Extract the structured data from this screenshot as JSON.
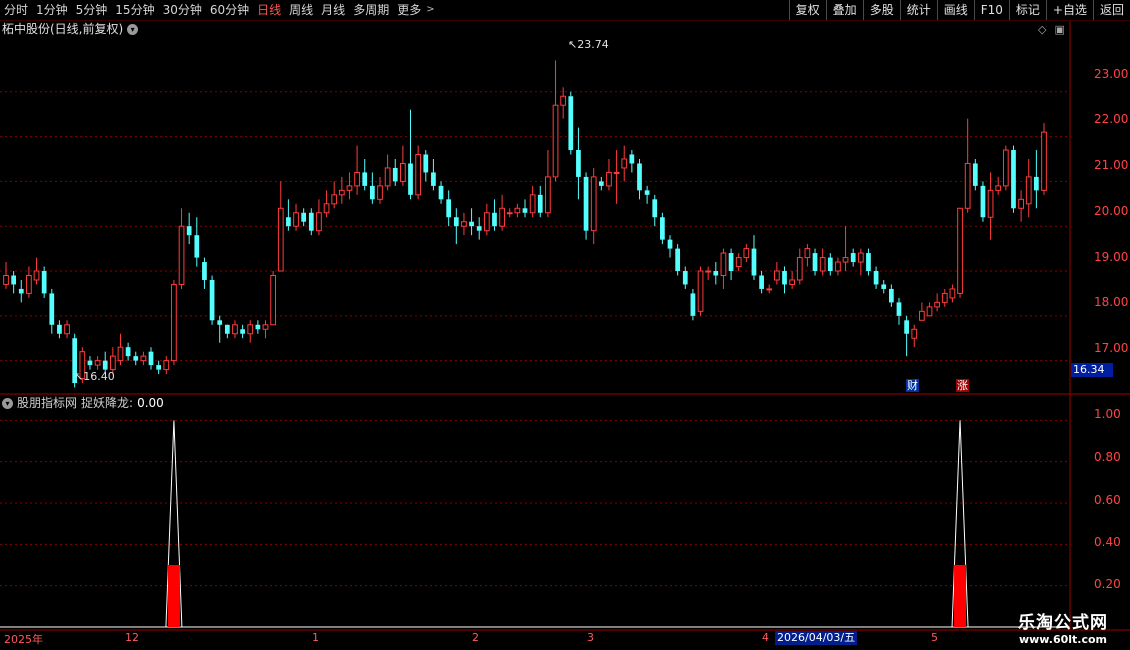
{
  "topbar": {
    "periods": [
      "分时",
      "1分钟",
      "5分钟",
      "15分钟",
      "30分钟",
      "60分钟",
      "日线",
      "周线",
      "月线",
      "多周期",
      "更多"
    ],
    "active_period": "日线",
    "more_caret": ">",
    "tools": [
      "复权",
      "叠加",
      "多股",
      "统计",
      "画线",
      "F10",
      "标记",
      "+自选",
      "返回"
    ]
  },
  "main_panel": {
    "title": "柘中股份(日线,前复权)",
    "high_label": "23.74",
    "low_label": "16.40",
    "current_price": "16.34",
    "price_axis": [
      "23.00",
      "22.00",
      "21.00",
      "20.00",
      "19.00",
      "18.00",
      "17.00"
    ],
    "badges": [
      "财",
      "涨"
    ]
  },
  "indicator_panel": {
    "name": "股朋指标网",
    "series_label": "捉妖降龙:",
    "series_value": "0.00",
    "axis": [
      "1.00",
      "0.80",
      "0.60",
      "0.40",
      "0.20"
    ]
  },
  "time_axis": {
    "labels": [
      "2025年",
      "12",
      "1",
      "2",
      "3",
      "4",
      "5"
    ],
    "selected_date": "2026/04/03/五"
  },
  "watermark": {
    "name": "乐淘公式网",
    "url": "www.60lt.com"
  },
  "colors": {
    "up": "#ff3c3c",
    "down": "#54ffff",
    "grid": "#8b0000",
    "background": "#000000"
  },
  "chart_data": {
    "type": "candlestick",
    "ylim": [
      16.3,
      24.2
    ],
    "candles": [
      [
        18.7,
        18.9,
        18.6,
        19.2
      ],
      [
        18.9,
        18.7,
        18.5,
        19.0
      ],
      [
        18.6,
        18.5,
        18.3,
        18.8
      ],
      [
        18.5,
        18.9,
        18.4,
        19.1
      ],
      [
        18.8,
        19.0,
        18.7,
        19.3
      ],
      [
        19.0,
        18.5,
        18.4,
        19.1
      ],
      [
        18.5,
        17.8,
        17.6,
        18.6
      ],
      [
        17.8,
        17.6,
        17.5,
        17.9
      ],
      [
        17.6,
        17.8,
        17.5,
        17.9
      ],
      [
        17.5,
        16.5,
        16.4,
        17.6
      ],
      [
        16.6,
        17.2,
        16.5,
        17.3
      ],
      [
        17.0,
        16.9,
        16.8,
        17.1
      ],
      [
        16.9,
        17.0,
        16.8,
        17.1
      ],
      [
        17.0,
        16.8,
        16.7,
        17.2
      ],
      [
        16.8,
        17.1,
        16.7,
        17.3
      ],
      [
        17.0,
        17.3,
        16.9,
        17.6
      ],
      [
        17.3,
        17.1,
        17.0,
        17.4
      ],
      [
        17.1,
        17.0,
        16.9,
        17.2
      ],
      [
        17.0,
        17.1,
        16.9,
        17.2
      ],
      [
        17.2,
        16.9,
        16.8,
        17.3
      ],
      [
        16.9,
        16.8,
        16.7,
        17.0
      ],
      [
        16.8,
        17.0,
        16.7,
        17.1
      ],
      [
        17.0,
        18.7,
        16.9,
        18.8
      ],
      [
        18.7,
        20.0,
        18.6,
        20.4
      ],
      [
        20.0,
        19.8,
        19.6,
        20.3
      ],
      [
        19.8,
        19.3,
        19.1,
        20.2
      ],
      [
        19.2,
        18.8,
        18.6,
        19.3
      ],
      [
        18.8,
        17.9,
        17.8,
        18.9
      ],
      [
        17.9,
        17.8,
        17.4,
        18.0
      ],
      [
        17.8,
        17.6,
        17.5,
        17.8
      ],
      [
        17.6,
        17.8,
        17.5,
        17.9
      ],
      [
        17.7,
        17.6,
        17.5,
        17.8
      ],
      [
        17.6,
        17.8,
        17.4,
        17.9
      ],
      [
        17.8,
        17.7,
        17.6,
        17.9
      ],
      [
        17.7,
        17.8,
        17.5,
        17.9
      ],
      [
        17.8,
        18.9,
        17.8,
        19.0
      ],
      [
        19.0,
        20.4,
        19.8,
        21.0
      ],
      [
        20.2,
        20.0,
        19.9,
        20.6
      ],
      [
        20.0,
        20.3,
        19.9,
        20.5
      ],
      [
        20.3,
        20.1,
        20.0,
        20.4
      ],
      [
        20.3,
        19.9,
        19.8,
        20.4
      ],
      [
        19.9,
        20.3,
        19.8,
        20.6
      ],
      [
        20.3,
        20.5,
        20.2,
        20.8
      ],
      [
        20.5,
        20.7,
        20.4,
        21.0
      ],
      [
        20.7,
        20.8,
        20.5,
        21.1
      ],
      [
        20.8,
        20.9,
        20.6,
        21.2
      ],
      [
        20.9,
        21.2,
        20.7,
        21.8
      ],
      [
        21.2,
        20.9,
        20.8,
        21.5
      ],
      [
        20.9,
        20.6,
        20.5,
        21.2
      ],
      [
        20.6,
        20.9,
        20.5,
        21.1
      ],
      [
        20.9,
        21.3,
        20.8,
        21.6
      ],
      [
        21.3,
        21.0,
        20.9,
        21.5
      ],
      [
        21.0,
        21.4,
        20.9,
        21.8
      ],
      [
        21.4,
        20.7,
        20.6,
        22.6
      ],
      [
        20.7,
        21.6,
        20.6,
        21.8
      ],
      [
        21.6,
        21.2,
        21.0,
        21.7
      ],
      [
        21.2,
        20.9,
        20.8,
        21.5
      ],
      [
        20.9,
        20.6,
        20.5,
        21.0
      ],
      [
        20.6,
        20.2,
        20.0,
        20.8
      ],
      [
        20.2,
        20.0,
        19.6,
        20.4
      ],
      [
        20.0,
        20.1,
        19.8,
        20.3
      ],
      [
        20.1,
        20.0,
        19.8,
        20.4
      ],
      [
        20.0,
        19.9,
        19.7,
        20.2
      ],
      [
        19.9,
        20.3,
        19.8,
        20.5
      ],
      [
        20.3,
        20.0,
        19.9,
        20.6
      ],
      [
        20.0,
        20.4,
        19.9,
        20.7
      ],
      [
        20.3,
        20.3,
        20.2,
        20.4
      ],
      [
        20.3,
        20.4,
        20.2,
        20.5
      ],
      [
        20.4,
        20.3,
        20.2,
        20.6
      ],
      [
        20.3,
        20.7,
        20.2,
        20.9
      ],
      [
        20.7,
        20.3,
        20.2,
        20.9
      ],
      [
        20.3,
        21.1,
        20.2,
        21.7
      ],
      [
        21.1,
        22.7,
        21.0,
        23.7
      ],
      [
        22.7,
        22.9,
        22.4,
        23.1
      ],
      [
        22.9,
        21.7,
        21.6,
        23.0
      ],
      [
        21.7,
        21.1,
        20.6,
        22.2
      ],
      [
        21.1,
        19.9,
        19.7,
        21.2
      ],
      [
        19.9,
        21.1,
        19.6,
        21.3
      ],
      [
        21.0,
        20.9,
        20.8,
        21.1
      ],
      [
        20.9,
        21.2,
        20.8,
        21.5
      ],
      [
        21.2,
        21.2,
        20.5,
        21.7
      ],
      [
        21.3,
        21.5,
        21.0,
        21.8
      ],
      [
        21.6,
        21.4,
        21.2,
        21.7
      ],
      [
        21.4,
        20.8,
        20.6,
        21.5
      ],
      [
        20.8,
        20.7,
        20.5,
        20.9
      ],
      [
        20.6,
        20.2,
        20.0,
        20.7
      ],
      [
        20.2,
        19.7,
        19.6,
        20.3
      ],
      [
        19.7,
        19.5,
        19.3,
        19.8
      ],
      [
        19.5,
        19.0,
        18.9,
        19.6
      ],
      [
        19.0,
        18.7,
        18.6,
        19.1
      ],
      [
        18.5,
        18.0,
        17.9,
        18.6
      ],
      [
        18.1,
        19.0,
        18.0,
        19.1
      ],
      [
        19.0,
        19.0,
        18.8,
        19.1
      ],
      [
        19.0,
        18.9,
        18.7,
        19.2
      ],
      [
        18.9,
        19.4,
        18.6,
        19.5
      ],
      [
        19.4,
        19.0,
        18.8,
        19.5
      ],
      [
        19.1,
        19.3,
        19.0,
        19.4
      ],
      [
        19.3,
        19.5,
        19.2,
        19.6
      ],
      [
        19.5,
        18.9,
        18.8,
        19.8
      ],
      [
        18.9,
        18.6,
        18.5,
        19.0
      ],
      [
        18.6,
        18.6,
        18.5,
        18.7
      ],
      [
        18.8,
        19.0,
        18.7,
        19.2
      ],
      [
        19.0,
        18.7,
        18.5,
        19.1
      ],
      [
        18.7,
        18.8,
        18.6,
        19.0
      ],
      [
        18.8,
        19.3,
        18.7,
        19.5
      ],
      [
        19.3,
        19.5,
        19.1,
        19.6
      ],
      [
        19.4,
        19.0,
        18.9,
        19.5
      ],
      [
        19.0,
        19.3,
        18.9,
        19.5
      ],
      [
        19.3,
        19.0,
        18.9,
        19.4
      ],
      [
        19.0,
        19.2,
        18.9,
        19.3
      ],
      [
        19.2,
        19.3,
        19.0,
        20.0
      ],
      [
        19.4,
        19.2,
        19.1,
        19.5
      ],
      [
        19.2,
        19.4,
        18.9,
        19.5
      ],
      [
        19.4,
        19.0,
        18.9,
        19.5
      ],
      [
        19.0,
        18.7,
        18.6,
        19.1
      ],
      [
        18.7,
        18.6,
        18.5,
        18.8
      ],
      [
        18.6,
        18.3,
        18.2,
        18.7
      ],
      [
        18.3,
        18.0,
        17.8,
        18.4
      ],
      [
        17.9,
        17.6,
        17.1,
        18.0
      ],
      [
        17.5,
        17.7,
        17.3,
        17.8
      ],
      [
        17.9,
        18.1,
        17.9,
        18.3
      ],
      [
        18.0,
        18.2,
        18.0,
        18.3
      ],
      [
        18.2,
        18.3,
        18.1,
        18.5
      ],
      [
        18.3,
        18.5,
        18.2,
        18.6
      ],
      [
        18.4,
        18.6,
        18.3,
        18.7
      ],
      [
        18.5,
        20.4,
        18.4,
        20.4
      ],
      [
        20.4,
        21.4,
        20.3,
        22.4
      ],
      [
        21.4,
        20.9,
        20.8,
        21.5
      ],
      [
        20.9,
        20.2,
        20.1,
        21.0
      ],
      [
        20.2,
        20.8,
        19.7,
        21.2
      ],
      [
        20.8,
        20.9,
        20.7,
        21.1
      ],
      [
        20.9,
        21.7,
        20.8,
        21.8
      ],
      [
        21.7,
        20.4,
        20.3,
        21.8
      ],
      [
        20.4,
        20.6,
        20.1,
        20.8
      ],
      [
        20.5,
        21.1,
        20.2,
        21.5
      ],
      [
        21.1,
        20.8,
        20.4,
        21.7
      ],
      [
        20.8,
        22.1,
        20.7,
        22.3
      ]
    ],
    "indicator": [
      0,
      0,
      0,
      0,
      0,
      0,
      0,
      0,
      0,
      0,
      0,
      0,
      0,
      0,
      0,
      0,
      0,
      0,
      0,
      0,
      0,
      0,
      1,
      0,
      0,
      0,
      0,
      0,
      0,
      0,
      0,
      0,
      0,
      0,
      0,
      0,
      0,
      0,
      0,
      0,
      0,
      0,
      0,
      0,
      0,
      0,
      0,
      0,
      0,
      0,
      0,
      0,
      0,
      0,
      0,
      0,
      0,
      0,
      0,
      0,
      0,
      0,
      0,
      0,
      0,
      0,
      0,
      0,
      0,
      0,
      0,
      0,
      0,
      0,
      0,
      0,
      0,
      0,
      0,
      0,
      0,
      0,
      0,
      0,
      0,
      0,
      0,
      0,
      0,
      0,
      0,
      0,
      0,
      0,
      0,
      0,
      0,
      0,
      0,
      0,
      0,
      0,
      0,
      0,
      0,
      0,
      0,
      0,
      0,
      0,
      0,
      0,
      0,
      0,
      0,
      0,
      0,
      0,
      0,
      0,
      0,
      0,
      0,
      0,
      0,
      1,
      0,
      0,
      0,
      0,
      0,
      0,
      0,
      0,
      0,
      0,
      0,
      0
    ]
  }
}
